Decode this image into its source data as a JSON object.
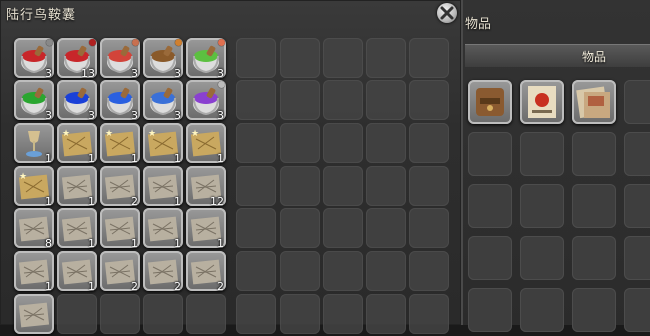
{
  "inventory": {
    "title": "陆行鸟鞍囊",
    "items": [
      {
        "icon": "red-dye-icon",
        "color": "#c8262a",
        "count": "3",
        "dot": "#888"
      },
      {
        "icon": "red-dye-icon",
        "color": "#c8262a",
        "count": "13",
        "dot": "#b02020"
      },
      {
        "icon": "red-dye-icon",
        "color": "#d2443a",
        "count": "3",
        "dot": "#c87050"
      },
      {
        "icon": "brown-dye-icon",
        "color": "#8a5a2a",
        "count": "3",
        "dot": "#d08030"
      },
      {
        "icon": "green-dye-icon",
        "color": "#5cc040",
        "count": "3",
        "dot": "#e07050"
      },
      {
        "icon": "green-dye-icon",
        "color": "#2aa630",
        "count": "3",
        "dot": ""
      },
      {
        "icon": "blue-dye-icon",
        "color": "#1a40d8",
        "count": "3",
        "dot": ""
      },
      {
        "icon": "blue-dye-icon",
        "color": "#2a60e0",
        "count": "3",
        "dot": ""
      },
      {
        "icon": "blue-dye-icon",
        "color": "#3a70d8",
        "count": "3",
        "dot": ""
      },
      {
        "icon": "purple-dye-icon",
        "color": "#8a40d0",
        "count": "3",
        "dot": "#bbb"
      },
      {
        "icon": "goblet-icon",
        "color": "#d4c090",
        "count": "1",
        "dot": ""
      },
      {
        "icon": "treasure-map-icon",
        "color": "#c9a860",
        "count": "1",
        "dot": ""
      },
      {
        "icon": "treasure-map-icon",
        "color": "#c9a860",
        "count": "1",
        "dot": ""
      },
      {
        "icon": "treasure-map-icon",
        "color": "#c9a860",
        "count": "1",
        "dot": ""
      },
      {
        "icon": "treasure-map-icon",
        "color": "#c9a860",
        "count": "1",
        "dot": ""
      },
      {
        "icon": "treasure-map-icon",
        "color": "#c9a860",
        "count": "1",
        "dot": ""
      },
      {
        "icon": "map-scroll-icon",
        "color": "#b8b0a0",
        "count": "1",
        "dot": ""
      },
      {
        "icon": "map-scroll-icon",
        "color": "#b8b0a0",
        "count": "2",
        "dot": ""
      },
      {
        "icon": "map-scroll-icon",
        "color": "#b8b0a0",
        "count": "1",
        "dot": ""
      },
      {
        "icon": "map-scroll-icon",
        "color": "#b8b0a0",
        "count": "12",
        "dot": ""
      },
      {
        "icon": "map-scroll-icon",
        "color": "#b8b0a0",
        "count": "8",
        "dot": ""
      },
      {
        "icon": "map-scroll-icon",
        "color": "#b8b0a0",
        "count": "1",
        "dot": ""
      },
      {
        "icon": "map-scroll-icon",
        "color": "#b8b0a0",
        "count": "1",
        "dot": ""
      },
      {
        "icon": "map-scroll-icon",
        "color": "#b8b0a0",
        "count": "1",
        "dot": ""
      },
      {
        "icon": "map-scroll-icon",
        "color": "#b8b0a0",
        "count": "1",
        "dot": ""
      },
      {
        "icon": "map-scroll-icon",
        "color": "#b8b0a0",
        "count": "1",
        "dot": ""
      },
      {
        "icon": "map-scroll-icon",
        "color": "#b8b0a0",
        "count": "1",
        "dot": ""
      },
      {
        "icon": "map-scroll-icon",
        "color": "#b8b0a0",
        "count": "2",
        "dot": ""
      },
      {
        "icon": "map-scroll-icon",
        "color": "#b8b0a0",
        "count": "2",
        "dot": ""
      },
      {
        "icon": "map-scroll-icon",
        "color": "#b8b0a0",
        "count": "2",
        "dot": ""
      },
      {
        "icon": "map-scroll-icon",
        "color": "#b8b0a0",
        "count": "",
        "dot": ""
      }
    ]
  },
  "items_panel": {
    "title": "物品",
    "tab": "物品",
    "items": [
      {
        "icon": "leather-bag-icon",
        "color": "#8a5a30"
      },
      {
        "icon": "event-flyer-icon",
        "color": "#e8dcc0"
      },
      {
        "icon": "posters-icon",
        "color": "#d8c8a8"
      }
    ]
  },
  "close_icon": "close-icon"
}
